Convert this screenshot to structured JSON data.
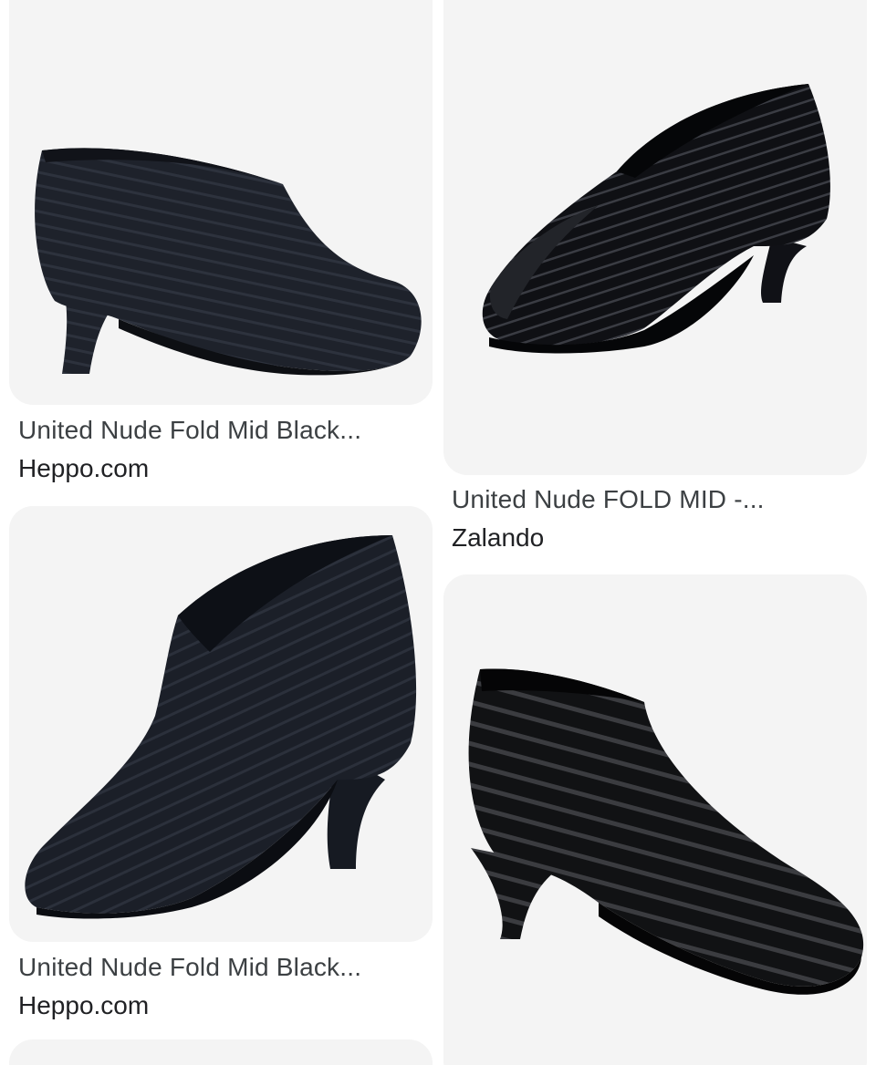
{
  "results": [
    {
      "title": "United Nude Fold Mid Black...",
      "source": "Heppo.com",
      "image_icon": "black-ankle-boot-image"
    },
    {
      "title": "United Nude FOLD MID -...",
      "source": "Zalando",
      "image_icon": "black-ankle-boot-image"
    },
    {
      "title": "United Nude Fold Mid Black...",
      "source": "Heppo.com",
      "image_icon": "black-ankle-boot-image"
    },
    {
      "title": "",
      "source": "",
      "image_icon": "black-ankle-boot-image"
    }
  ],
  "colors": {
    "thumb_background": "#f4f4f4",
    "title_text": "#3c4043",
    "source_text": "#202124",
    "shoe": "#1c1f26"
  }
}
